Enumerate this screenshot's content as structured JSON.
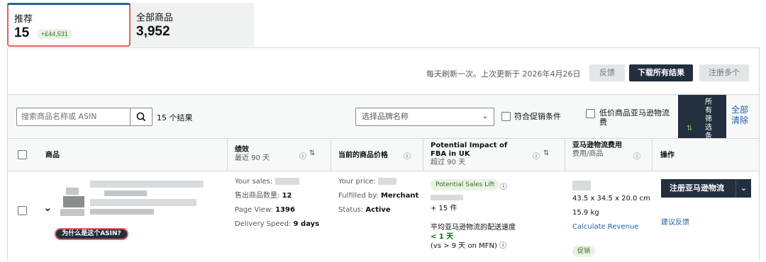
{
  "cards": [
    {
      "label": "推荐",
      "value": "15",
      "badge": "+£44,531"
    },
    {
      "label": "全部商品",
      "value": "3,952"
    }
  ],
  "info": {
    "update_note": "每天刷新一次。上次更新于 2026年4月26日",
    "feedback": "反馈",
    "download": "下载所有结果",
    "register_multi": "注册多个"
  },
  "filters": {
    "search_placeholder": "搜索商品名称或 ASIN",
    "result_count": "15 个结果",
    "brand_placeholder": "选择品牌名称",
    "promo_label": "符合促销条件",
    "low_price_label": "低价商品亚马逊物流费",
    "all_filters": "所有筛选条",
    "clear_all": "全部清除"
  },
  "columns": {
    "product": "商品",
    "performance": "绩效",
    "performance_sub": "最近 90 天",
    "price": "当前的商品价格",
    "impact": "Potential Impact of FBA in UK",
    "impact_sub": "超过 90 天",
    "fee": "亚马逊物流费用",
    "fee_sub": "费用/商品",
    "actions": "操作"
  },
  "row": {
    "why_label": "为什么是这个ASIN?",
    "perf": {
      "sales_label": "Your sales:",
      "units_label": "售出商品数量:",
      "units_value": "12",
      "pageview_label": "Page View:",
      "pageview_value": "1396",
      "speed_label": "Delivery Speed:",
      "speed_value": "9 days"
    },
    "price": {
      "price_label": "Your price:",
      "fulfilled_label": "Fulfilled by:",
      "fulfilled_value": "Merchant",
      "status_label": "Status:",
      "status_value": "Active"
    },
    "impact": {
      "tag": "Potential Sales Lift",
      "units": "+ 15 件",
      "speed_title": "平均亚马逊物流的配送速度",
      "speed_value": "< 1 天",
      "compare": "(vs > 9 天 on MFN)"
    },
    "fee": {
      "dimensions": "43.5 x 34.5 x 20.0 cm",
      "weight": "15.9 kg",
      "calc_link": "Calculate Revenue",
      "promo_tag": "促销"
    },
    "actions": {
      "register": "注册亚马逊物流",
      "feedback_link": "建议反馈"
    }
  },
  "colors": {
    "accent_dark": "#232f3e",
    "link": "#2162a1",
    "highlight": "#e3625c",
    "success_bg": "#e8f3e3",
    "success_text": "#3b6b2a"
  }
}
